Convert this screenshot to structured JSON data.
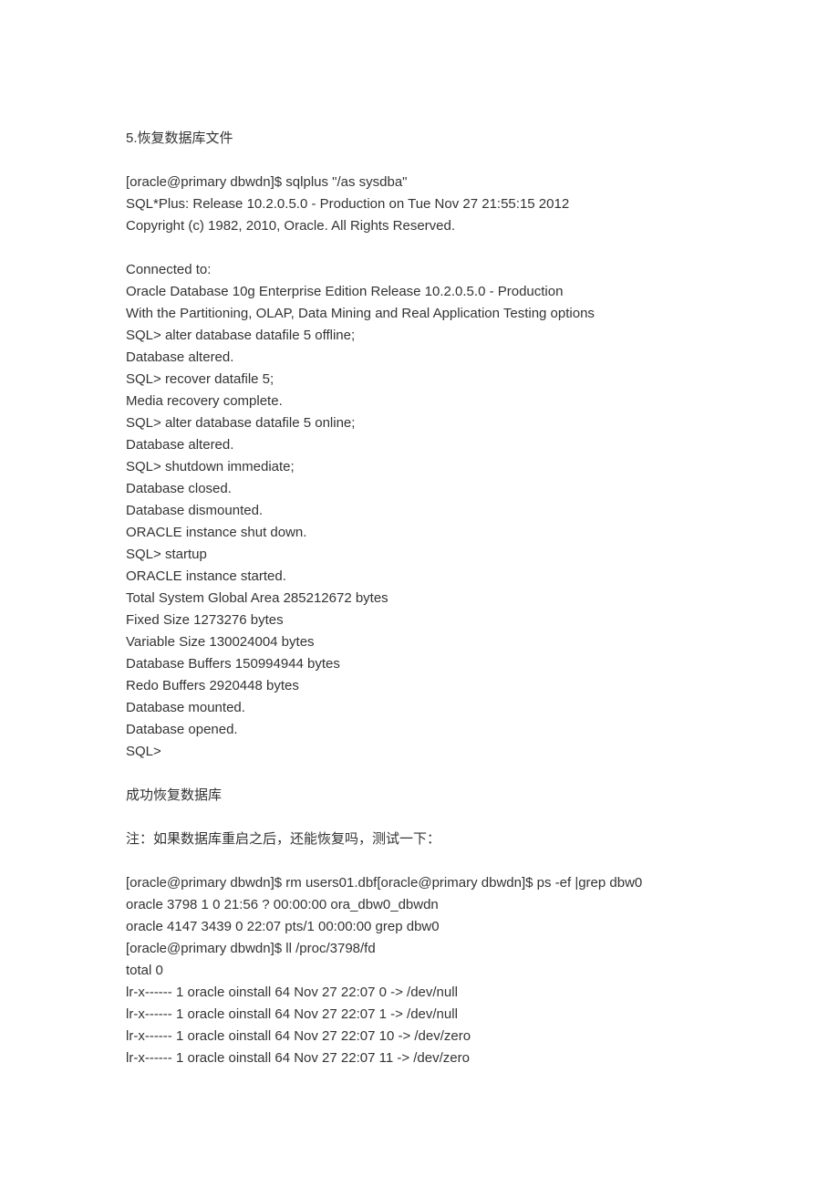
{
  "heading": "5.恢复数据库文件",
  "block1": [
    "[oracle@primary dbwdn]$ sqlplus \"/as sysdba\"",
    "SQL*Plus: Release 10.2.0.5.0 - Production on Tue Nov 27 21:55:15 2012",
    "Copyright (c) 1982, 2010, Oracle. All Rights Reserved."
  ],
  "block2": [
    "Connected to:",
    "Oracle Database 10g Enterprise Edition Release 10.2.0.5.0 - Production",
    "With the Partitioning, OLAP, Data Mining and Real Application Testing options",
    "SQL> alter database datafile 5 offline;",
    "Database altered.",
    "SQL> recover datafile 5;",
    "Media recovery complete.",
    "SQL> alter database datafile 5 online;",
    "Database altered.",
    "SQL> shutdown immediate;",
    "Database closed.",
    "Database dismounted.",
    "ORACLE instance shut down.",
    "SQL> startup",
    "ORACLE instance started.",
    "Total System Global Area 285212672 bytes",
    "Fixed Size 1273276 bytes",
    "Variable Size 130024004 bytes",
    "Database Buffers 150994944 bytes",
    "Redo Buffers 2920448 bytes",
    "Database mounted.",
    "Database opened.",
    "SQL>"
  ],
  "block3": [
    "成功恢复数据库"
  ],
  "block4": [
    "注：如果数据库重启之后，还能恢复吗，测试一下："
  ],
  "block5": [
    "[oracle@primary dbwdn]$ rm users01.dbf[oracle@primary dbwdn]$ ps -ef |grep dbw0",
    "oracle 3798 1 0 21:56 ? 00:00:00 ora_dbw0_dbwdn",
    "oracle 4147 3439 0 22:07 pts/1 00:00:00 grep dbw0",
    "[oracle@primary dbwdn]$ ll /proc/3798/fd",
    "total 0",
    "lr-x------ 1 oracle oinstall 64 Nov 27 22:07 0 -> /dev/null",
    "lr-x------ 1 oracle oinstall 64 Nov 27 22:07 1 -> /dev/null",
    "lr-x------ 1 oracle oinstall 64 Nov 27 22:07 10 -> /dev/zero",
    "lr-x------ 1 oracle oinstall 64 Nov 27 22:07 11 -> /dev/zero"
  ]
}
